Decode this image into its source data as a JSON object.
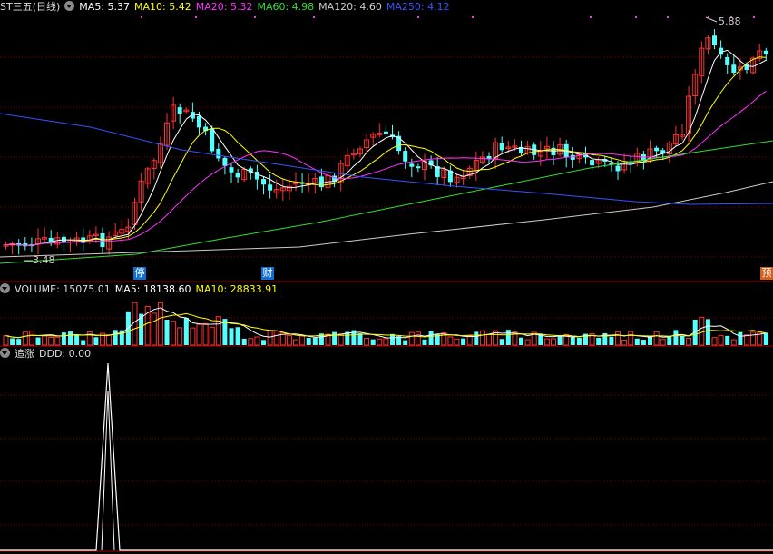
{
  "main_panel": {
    "title": "ST三五(日线)",
    "ma": [
      {
        "label": "MA5: 5.37",
        "color": "#ffffff"
      },
      {
        "label": "MA10: 5.42",
        "color": "#ffff00"
      },
      {
        "label": "MA20: 5.32",
        "color": "#ff33ff"
      },
      {
        "label": "MA60: 4.98",
        "color": "#33dd33"
      },
      {
        "label": "MA120: 4.60",
        "color": "#cccccc"
      },
      {
        "label": "MA250: 4.12",
        "color": "#3355ff"
      }
    ],
    "high_label": "5.88",
    "low_label": "3.48",
    "markers": [
      {
        "text": "停",
        "bg": "#1070d0"
      },
      {
        "text": "财",
        "bg": "#1070d0"
      },
      {
        "text": "预",
        "bg": "#d06020"
      }
    ]
  },
  "volume_panel": {
    "title": "VOLUME: 15075.01",
    "ma5": "MA5: 18138.60",
    "ma10": "MA10: 28833.91"
  },
  "indicator_panel": {
    "title": "追涨",
    "value": "DDD: 0.00"
  },
  "colors": {
    "up": "#ff3232",
    "down": "#54ffff",
    "grid": "#7a0000",
    "ma5": "#ffffff",
    "ma10": "#ffff00",
    "ma20": "#ff33ff",
    "ma60": "#33dd33",
    "ma120": "#cccccc",
    "ma250": "#3355ff"
  }
}
